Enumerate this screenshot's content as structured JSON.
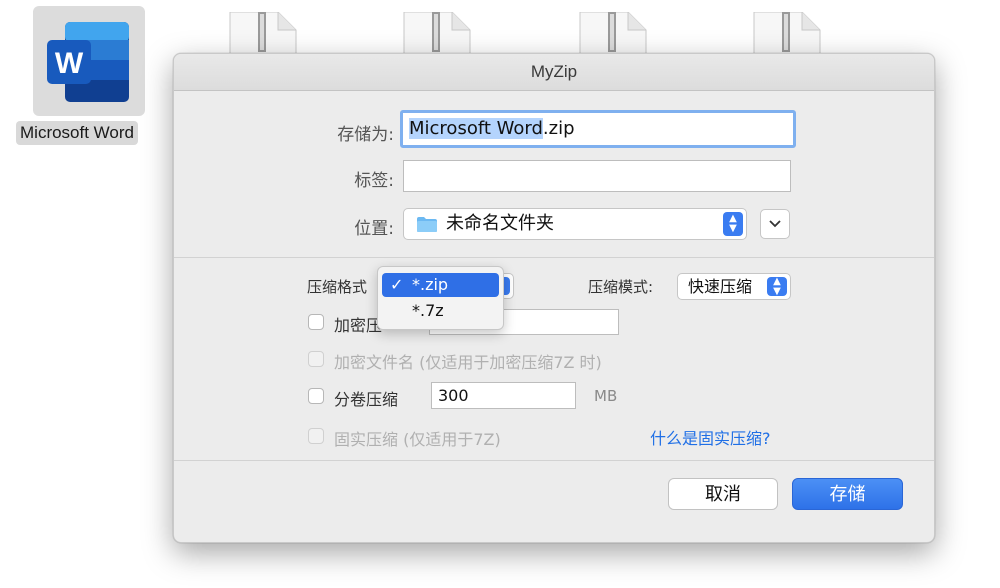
{
  "desktop": {
    "app_icon_label": "Microsoft Word",
    "word_letter": "W"
  },
  "dialog": {
    "title": "MyZip",
    "save_as_label": "存储为:",
    "save_as_name": "Microsoft Word",
    "save_as_ext": ".zip",
    "tags_label": "标签:",
    "tags_value": "",
    "location_label": "位置:",
    "location_value": "未命名文件夹",
    "format_label": "压缩格式",
    "format_options": [
      "*.zip",
      "*.7z"
    ],
    "format_selected": "*.zip",
    "mode_label": "压缩模式:",
    "mode_value": "快速压缩",
    "encrypt_label": "加密压",
    "password_value": "",
    "encrypt_name_label": "加密文件名 (仅适用于加密压缩7Z 时)",
    "split_label": "分卷压缩",
    "split_value": "300",
    "split_unit": "MB",
    "solid_label": "固实压缩 (仅适用于7Z)",
    "solid_help_link": "什么是固实压缩?",
    "cancel_label": "取消",
    "save_label": "存储"
  },
  "colors": {
    "accent": "#2f6fe6",
    "link": "#1f6fe6",
    "selection": "#b4d4fd",
    "focus_ring": "#7fb0ef"
  }
}
